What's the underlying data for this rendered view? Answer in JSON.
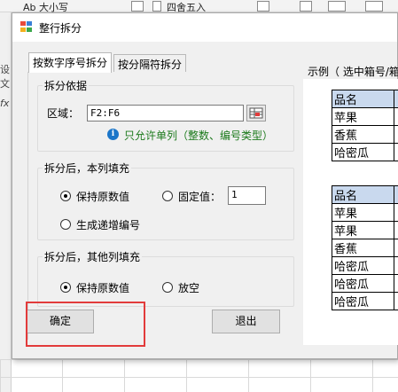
{
  "ribbon": {
    "font_size_label": "Ab 大小写",
    "rounding_label": "四舍五入"
  },
  "sheet": {
    "row_label": "设文",
    "fx_label": "fx"
  },
  "dialog": {
    "title": "整行拆分",
    "tabs": [
      "按数字序号拆分",
      "按分隔符拆分"
    ],
    "split_basis": {
      "group_title": "拆分依据",
      "range_label": "区域：",
      "range_value": "F2:F6",
      "info_text": "只允许单列（整数、编号类型）"
    },
    "this_col_fill": {
      "group_title": "拆分后，本列填充",
      "keep_original": "保持原数值",
      "fixed_value": "固定值：",
      "fixed_value_input": "1",
      "incremental": "生成递增编号",
      "selected": "keep_original"
    },
    "other_col_fill": {
      "group_title": "拆分后，其他列填充",
      "keep_original": "保持原数值",
      "leave_empty": "放空",
      "selected": "keep_original"
    },
    "ok_button": "确定",
    "exit_button": "退出",
    "example": {
      "title": "示例（ 选中箱号/箱",
      "table1": {
        "header": "品名",
        "rows": [
          "苹果",
          "香蕉",
          "哈密瓜"
        ]
      },
      "table2": {
        "header": "品名",
        "rows": [
          "苹果",
          "苹果",
          "香蕉",
          "哈密瓜",
          "哈密瓜",
          "哈密瓜"
        ]
      }
    }
  },
  "colors": {
    "highlight_border": "#e23b3b",
    "info_text": "#1c7a1c",
    "table_header": "#c9d9ee"
  }
}
